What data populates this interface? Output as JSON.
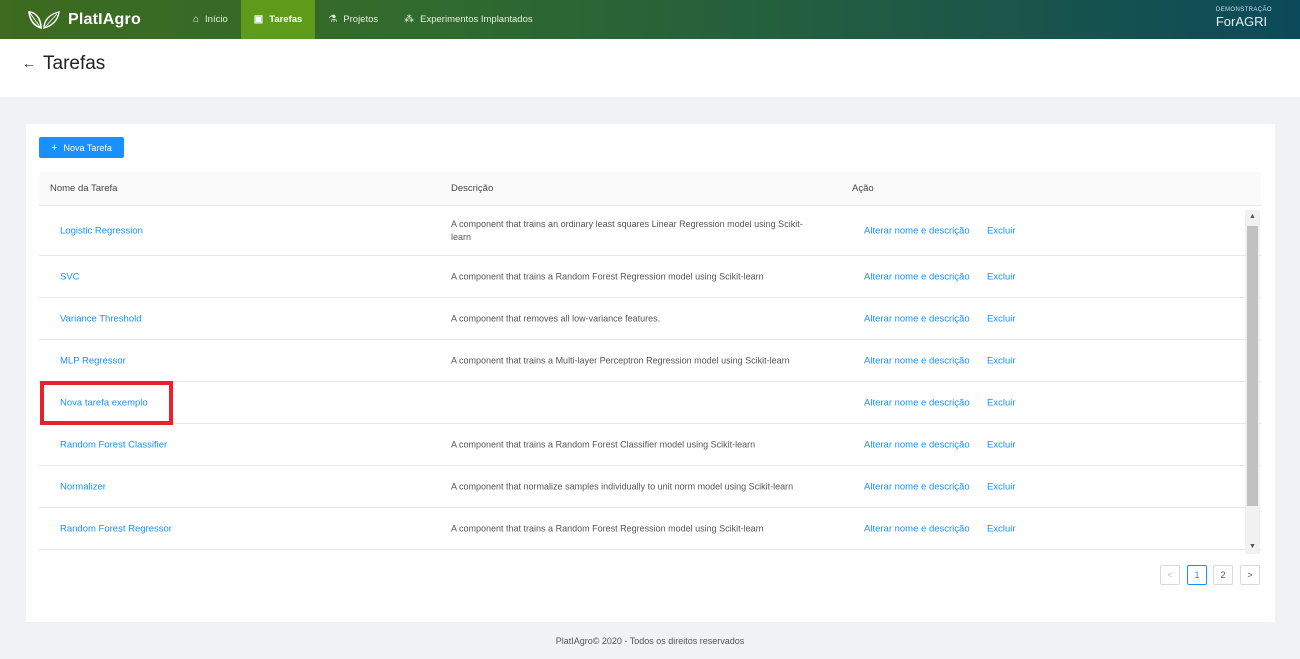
{
  "header": {
    "logo_text": "PlatIAgro",
    "nav": [
      {
        "label": "Início",
        "icon": "home-icon",
        "active": false
      },
      {
        "label": "Tarefas",
        "icon": "image-icon",
        "active": true
      },
      {
        "label": "Projetos",
        "icon": "flask-icon",
        "active": false
      },
      {
        "label": "Experimentos Implantados",
        "icon": "cluster-icon",
        "active": false
      }
    ],
    "brand_small": "DEMONSTRAÇÃO",
    "brand_big": "ForAGRI"
  },
  "page": {
    "title": "Tarefas"
  },
  "toolbar": {
    "new_task_label": "Nova Tarefa"
  },
  "table": {
    "columns": [
      "Nome da Tarefa",
      "Descrição",
      "Ação"
    ],
    "rows": [
      {
        "name": "Logistic Regression",
        "description": "A component that trains an ordinary least squares Linear Regression model using Scikit-learn",
        "edit": "Alterar nome e descrição",
        "delete": "Excluir"
      },
      {
        "name": "SVC",
        "description": "A component that trains a Random Forest Regression model using Scikit-learn",
        "edit": "Alterar nome e descrição",
        "delete": "Excluir"
      },
      {
        "name": "Variance Threshold",
        "description": "A component that removes all low-variance features.",
        "edit": "Alterar nome e descrição",
        "delete": "Excluir"
      },
      {
        "name": "MLP Regressor",
        "description": "A component that trains a Multi-layer Perceptron Regression model using Scikit-learn",
        "edit": "Alterar nome e descrição",
        "delete": "Excluir"
      },
      {
        "name": "Nova tarefa exemplo",
        "description": "",
        "edit": "Alterar nome e descrição",
        "delete": "Excluir"
      },
      {
        "name": "Random Forest Classifier",
        "description": "A component that trains a Random Forest Classifier model using Scikit-learn",
        "edit": "Alterar nome e descrição",
        "delete": "Excluir"
      },
      {
        "name": "Normalizer",
        "description": "A component that normalize samples individually to unit norm model using Scikit-learn",
        "edit": "Alterar nome e descrição",
        "delete": "Excluir"
      },
      {
        "name": "Random Forest Regressor",
        "description": "A component that trains a Random Forest Regression model using Scikit-learn",
        "edit": "Alterar nome e descrição",
        "delete": "Excluir"
      }
    ]
  },
  "pagination": {
    "prev": "<",
    "pages": [
      "1",
      "2"
    ],
    "current": "1",
    "next": ">"
  },
  "footer": {
    "text": "PlatIAgro© 2020 - Todos os direitos reservados"
  },
  "colors": {
    "accent": "#1890ff",
    "nav_active": "#5e9b1a",
    "highlight": "#e8212c"
  }
}
